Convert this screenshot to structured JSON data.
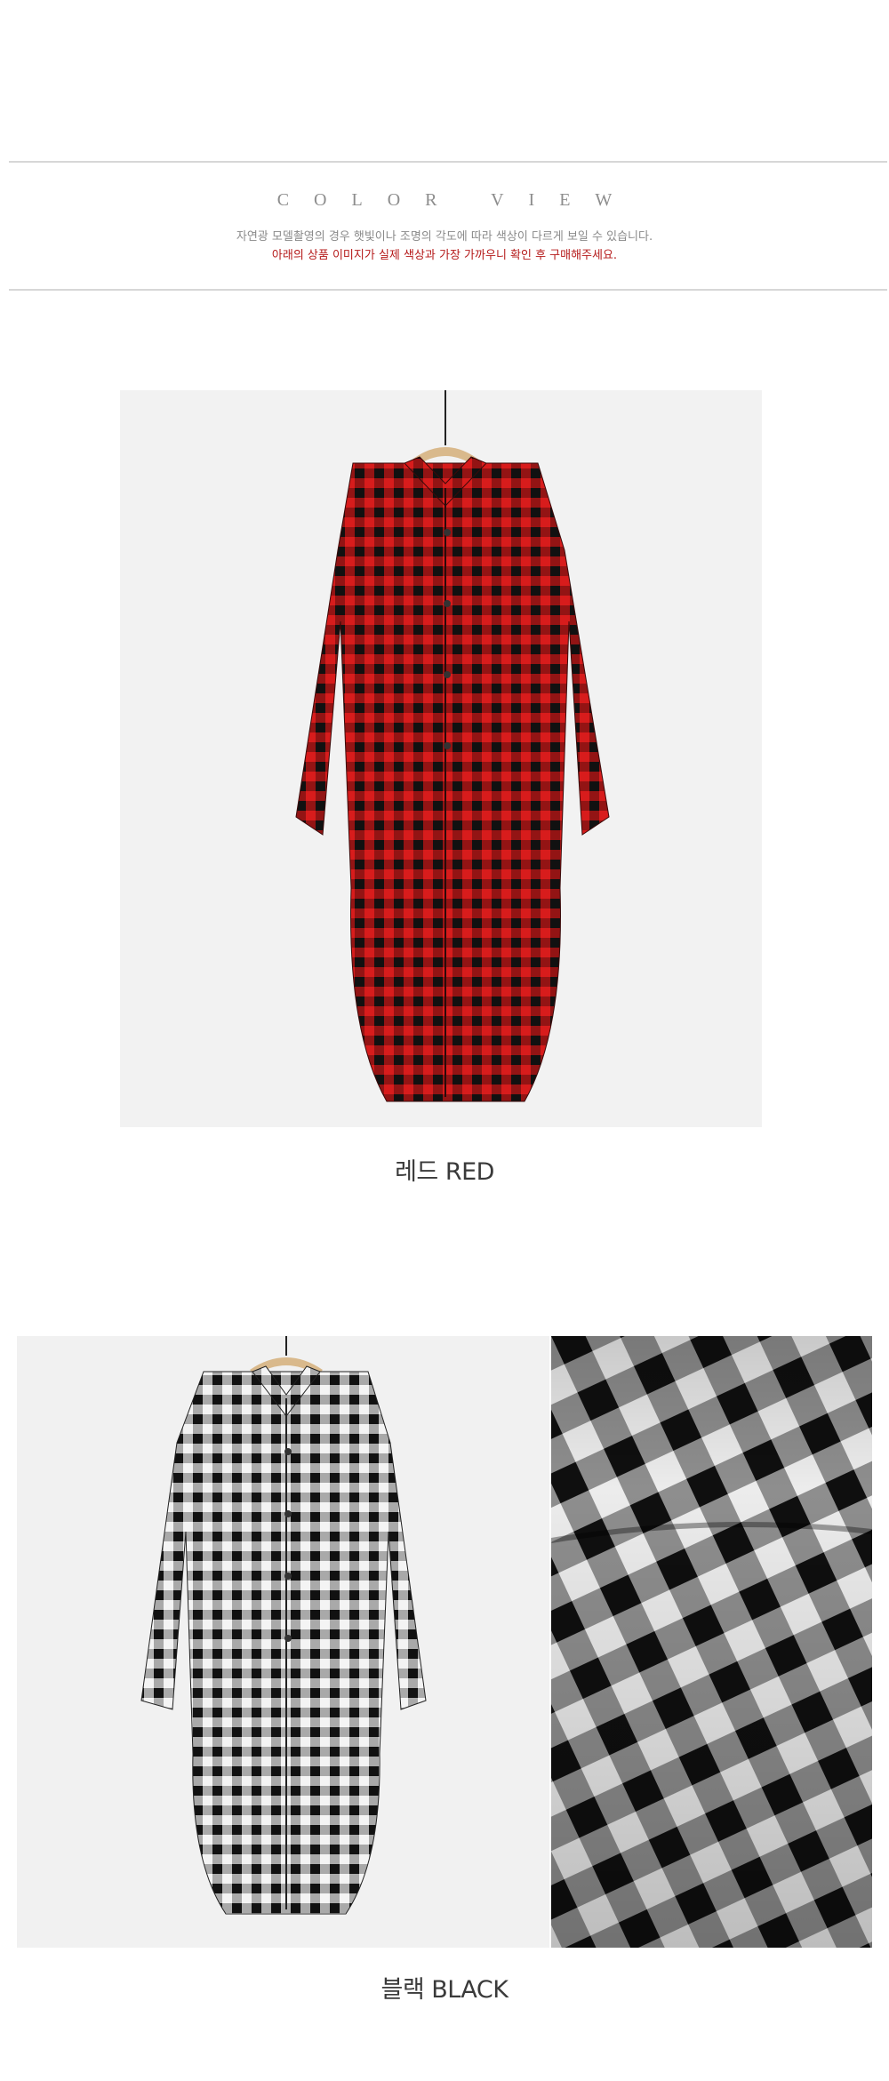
{
  "header": {
    "title": "COLOR VIEW",
    "notice_line1": "자연광 모델촬영의 경우 햇빛이나 조명의 각도에 따라 색상이 다르게 보일 수 있습니다.",
    "notice_line2": "아래의 상품 이미지가 실제 색상과 가장 가까우니 확인 후 구매해주세요."
  },
  "products": [
    {
      "caption": "레드 RED",
      "check_color": "#d81c1c",
      "line_color": "#111111"
    },
    {
      "caption": "블랙 BLACK",
      "check_color": "#f4f4f4",
      "line_color": "#111111"
    }
  ],
  "detail_photo": {
    "colors": [
      "#111111",
      "#e9e9e9",
      "#7a7a7a"
    ]
  }
}
